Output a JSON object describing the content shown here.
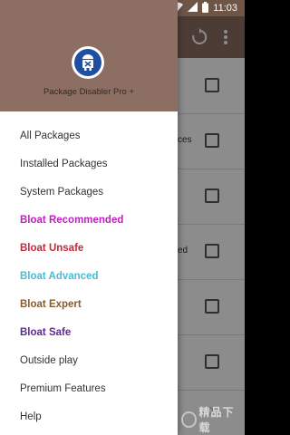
{
  "status_bar": {
    "time": "11:03",
    "icons": [
      "wifi-icon",
      "signal-icon",
      "battery-icon"
    ]
  },
  "app_behind": {
    "toolbar_icons": [
      "refresh-icon",
      "overflow-menu-icon"
    ],
    "row_peeks": [
      "",
      "ces",
      "",
      "ed",
      "",
      ""
    ]
  },
  "drawer": {
    "app_name": "Package Disabler Pro +",
    "menu_items": [
      {
        "label": "All Packages",
        "color": "#333333"
      },
      {
        "label": "Installed Packages",
        "color": "#333333"
      },
      {
        "label": "System Packages",
        "color": "#333333"
      },
      {
        "label": "Bloat Recommended",
        "color": "#c21fc2"
      },
      {
        "label": "Bloat Unsafe",
        "color": "#c6283a"
      },
      {
        "label": "Bloat Advanced",
        "color": "#4bbcd4"
      },
      {
        "label": "Bloat Expert",
        "color": "#8b5a2b"
      },
      {
        "label": "Bloat Safe",
        "color": "#5b2a8c"
      },
      {
        "label": "Outside play",
        "color": "#333333"
      },
      {
        "label": "Premium Features",
        "color": "#333333"
      },
      {
        "label": "Help",
        "color": "#333333"
      }
    ]
  },
  "watermark": {
    "text": "精品下载"
  }
}
